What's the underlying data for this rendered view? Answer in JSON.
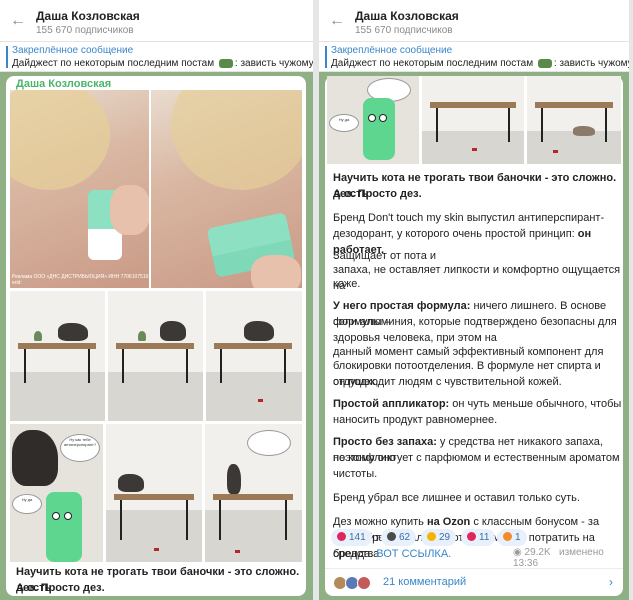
{
  "channel": {
    "name": "Даша Козловская",
    "subscribers": "155 670 подписчиков"
  },
  "pinned": {
    "title": "Закреплённое сообщение",
    "left_text": "Дайджест по некоторым последним постам",
    "left_tail": ": зависть чужому сча",
    "right_text": "Дайджест по некоторым последним постам",
    "right_tail": ": зависть чужому сч"
  },
  "left_post": {
    "author": "Даша Козловская",
    "photo_caption": "Реклама ООО «ДНС ДИСТРИБЬЮЦИЯ» ИНН 7706107510 erid:",
    "comic_speech": "Ну как тебе антиперспирант?",
    "comic_char_label": "Ну да",
    "text_line1": "Научить кота не трогать твои баночки - это сложно. А есть",
    "text_line2": "дез. Просто дез."
  },
  "right_post": {
    "comic_char_label": "Ну да",
    "p1_line1": "Научить кота не трогать твои баночки - это сложно. А есть",
    "p1_line2": "дез. Просто дез.",
    "p2_line1": "Бренд Don't touch my skin выпустил антиперспирант-",
    "p2_line2a": "дезодорант, у которого очень простой принцип: ",
    "p2_line2b": "он работает.",
    "p3_line1": "Защищает от пота и",
    "p3_line2": "запаха, не оставляет липкости и комфортно ощущается на",
    "p3_line3": "коже.",
    "p4_bold": "У него простая формула:",
    "p4_line1": " ничего лишнего. В основе формулы –",
    "p4_line2": "соли алюминия, которые подтверждено безопасны для",
    "p4_line3": "здоровья человека, при этом на",
    "p4_line4": "данный момент самый эффективный компонент для",
    "p4_line5": "блокировки потоотделения. В формуле нет спирта и отдушек,",
    "p4_line6": "он подходит людям с чувствительной кожей.",
    "p5_bold": "Простой аппликатор:",
    "p5_line1": " он чуть меньше обычного, чтобы",
    "p5_line2": "наносить продукт равномернее.",
    "p6_bold": "Просто без запаха:",
    "p6_line1": " у средства нет никакого запаха, поэтому оно",
    "p6_line2": "не конфликтует с парфюмом и естественным ароматом",
    "p6_line3": "чистоты.",
    "p7_line1": "Бренд убрал все лишнее и оставил только суть.",
    "p8_line1a": "Дез можно купить ",
    "p8_bold": "на Ozon",
    "p8_line1b": " с классным бонусом - за отзыв бренд",
    "p8_line2": "начислит 400 баллов, которые можно потратить на средства",
    "p8_line3a": "бренда. ",
    "p8_link": "ВОТ ССЫЛКА.",
    "reactions": [
      {
        "count": "141",
        "color": "#e0245e"
      },
      {
        "count": "62",
        "color": "#4a4a4a"
      },
      {
        "count": "29",
        "color": "#f4b400"
      },
      {
        "count": "11",
        "color": "#e0245e"
      },
      {
        "count": "1",
        "color": "#f28c28"
      }
    ],
    "views": "29.2K",
    "edited": "изменено",
    "time": "13:36",
    "comments": "21 комментарий"
  },
  "icons": {
    "back": "arrow-left-icon",
    "views": "eye-icon",
    "chevron": "chevron-right-icon"
  }
}
